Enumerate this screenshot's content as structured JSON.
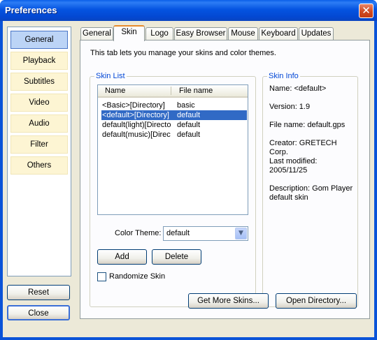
{
  "window": {
    "title": "Preferences",
    "close_glyph": "✕"
  },
  "sidebar": {
    "items": [
      {
        "label": "General",
        "active": true
      },
      {
        "label": "Playback"
      },
      {
        "label": "Subtitles"
      },
      {
        "label": "Video"
      },
      {
        "label": "Audio"
      },
      {
        "label": "Filter"
      },
      {
        "label": "Others"
      }
    ]
  },
  "footer": {
    "reset_label": "Reset",
    "close_label": "Close"
  },
  "tabs": [
    {
      "label": "General"
    },
    {
      "label": "Skin",
      "active": true
    },
    {
      "label": "Logo"
    },
    {
      "label": "Easy Browser"
    },
    {
      "label": "Mouse"
    },
    {
      "label": "Keyboard"
    },
    {
      "label": "Updates"
    }
  ],
  "skin": {
    "intro": "This tab lets you manage your skins and color themes.",
    "skin_list": {
      "title": "Skin List",
      "columns": [
        "Name",
        "File name"
      ],
      "rows": [
        {
          "name": "<Basic>[Directory]",
          "file": "basic"
        },
        {
          "name": "<default>[Directory]",
          "file": "default",
          "selected": true
        },
        {
          "name": "default(light)[Director...",
          "file": "default"
        },
        {
          "name": "default(music)[Direct...",
          "file": "default"
        }
      ]
    },
    "color_theme": {
      "label": "Color Theme:",
      "value": "default"
    },
    "add_label": "Add",
    "delete_label": "Delete",
    "randomize_label": "Randomize Skin",
    "randomize_checked": false,
    "info": {
      "title": "Skin Info",
      "name": "Name: <default>",
      "version": "Version: 1.9",
      "file_name": "File name: default.gps",
      "creator": "Creator: GRETECH Corp.",
      "last_modified_label": "Last modified:",
      "last_modified_value": "2005/11/25",
      "description_line1": "Description: Gom Player",
      "description_line2": "default skin"
    },
    "get_more_label": "Get More Skins...",
    "open_dir_label": "Open Directory..."
  },
  "colors": {
    "title_bar": "#0a53d8",
    "selection": "#316ac5",
    "group_label": "#0046d5",
    "sidebar_button": "#fdf5d3",
    "active_tab_accent": "#e68b2c"
  }
}
